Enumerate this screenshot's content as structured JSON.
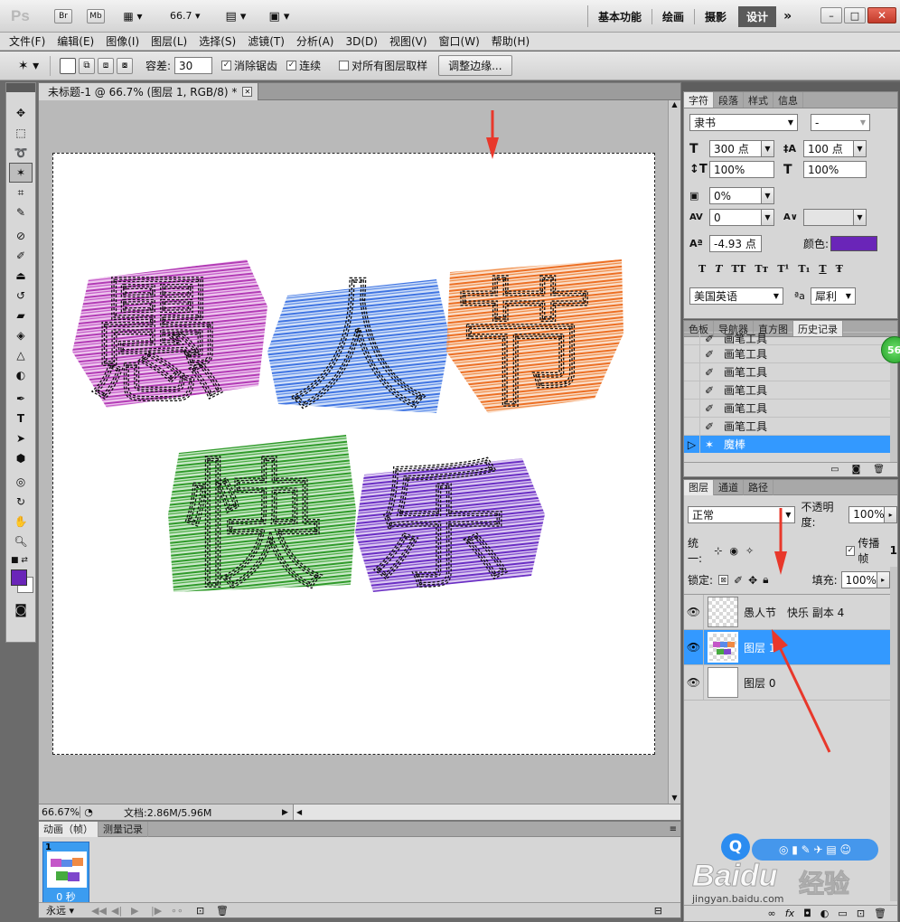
{
  "app": {
    "logo": "Ps",
    "br": "Br",
    "mb": "Mb",
    "zoom": "66.7"
  },
  "workspaces": [
    "基本功能",
    "绘画",
    "摄影",
    "设计"
  ],
  "menu": [
    "文件(F)",
    "编辑(E)",
    "图像(I)",
    "图层(L)",
    "选择(S)",
    "滤镜(T)",
    "分析(A)",
    "3D(D)",
    "视图(V)",
    "窗口(W)",
    "帮助(H)"
  ],
  "options": {
    "tolerance_label": "容差:",
    "tolerance_value": "30",
    "antialias_label": "消除锯齿",
    "contiguous_label": "连续",
    "sample_all_label": "对所有图层取样",
    "refine_edge": "调整边缘..."
  },
  "document": {
    "tab_title": "未标题-1 @ 66.7% (图层 1, RGB/8) *",
    "zoom_status": "66.67%",
    "doc_info": "文档:2.86M/5.96M"
  },
  "canvas_text": {
    "line1": [
      "愚",
      "人",
      "节"
    ],
    "line2": [
      "快",
      "乐"
    ]
  },
  "char_panel": {
    "tabs": [
      "字符",
      "段落",
      "样式",
      "信息"
    ],
    "font_family": "隶书",
    "font_style": "-",
    "font_size": "300 点",
    "leading": "100 点",
    "vscale": "100%",
    "hscale": "100%",
    "tracking_pct": "0%",
    "kerning": "0",
    "baseline": "-4.93 点",
    "color_label": "颜色:",
    "type_styles": [
      "T",
      "T",
      "TT",
      "Tт",
      "T¹",
      "T₁",
      "T",
      "Ŧ"
    ],
    "language": "美国英语",
    "aa_label": "ªa",
    "antialias": "犀利"
  },
  "history_panel": {
    "tabs": [
      "色板",
      "导航器",
      "直方图",
      "历史记录"
    ],
    "items": [
      "画笔工具",
      "画笔工具",
      "画笔工具",
      "画笔工具",
      "画笔工具",
      "画笔工具"
    ],
    "current": "魔棒",
    "badge": "56"
  },
  "layers_panel": {
    "tabs": [
      "图层",
      "通道",
      "路径"
    ],
    "blend_mode": "正常",
    "opacity_label": "不透明度:",
    "opacity": "100%",
    "unify_label": "统一:",
    "propagate_label": "传播帧",
    "propagate_suffix": "1",
    "lock_label": "锁定:",
    "fill_label": "填充:",
    "fill": "100%",
    "layers": [
      {
        "name": "愚人节　快乐 副本 4"
      },
      {
        "name": "图层 1"
      },
      {
        "name": "图层 0"
      }
    ]
  },
  "animation": {
    "tabs": [
      "动画（帧）",
      "测量记录"
    ],
    "frame_number": "1",
    "frame_time": "0 秒",
    "loop": "永远"
  },
  "watermark": {
    "brand": "Baidu",
    "cn": "经验",
    "url": "jingyan.baidu.com"
  },
  "colors": {
    "accent": "#3399ff",
    "foreground": "#6a25b8",
    "selection_blue": "#3b9cf0",
    "annotation_arrow": "#e8382b",
    "canvas_bg": "#b9b9b9",
    "panel_bg": "#d6d6d6"
  }
}
